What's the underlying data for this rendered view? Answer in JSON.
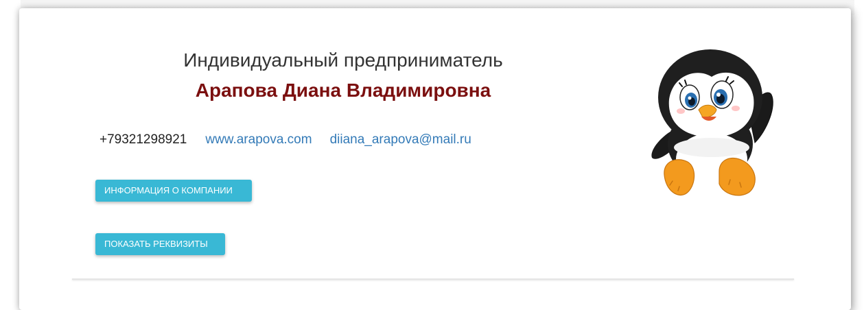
{
  "profile": {
    "title": "Индивидуальный предприниматель",
    "name": "Арапова Диана Владимировна"
  },
  "contacts": {
    "phone": "+79321298921",
    "website": "www.arapova.com",
    "email": "diiana_arapova@mail.ru"
  },
  "buttons": {
    "company_info": "ИНФОРМАЦИЯ О КОМПАНИИ",
    "show_details": "ПОКАЗАТЬ РЕКВИЗИТЫ"
  },
  "mascot": {
    "icon": "penguin-icon"
  },
  "colors": {
    "name_color": "#7b0f0f",
    "link_color": "#337ab7",
    "button_bg": "#39b8d5"
  }
}
